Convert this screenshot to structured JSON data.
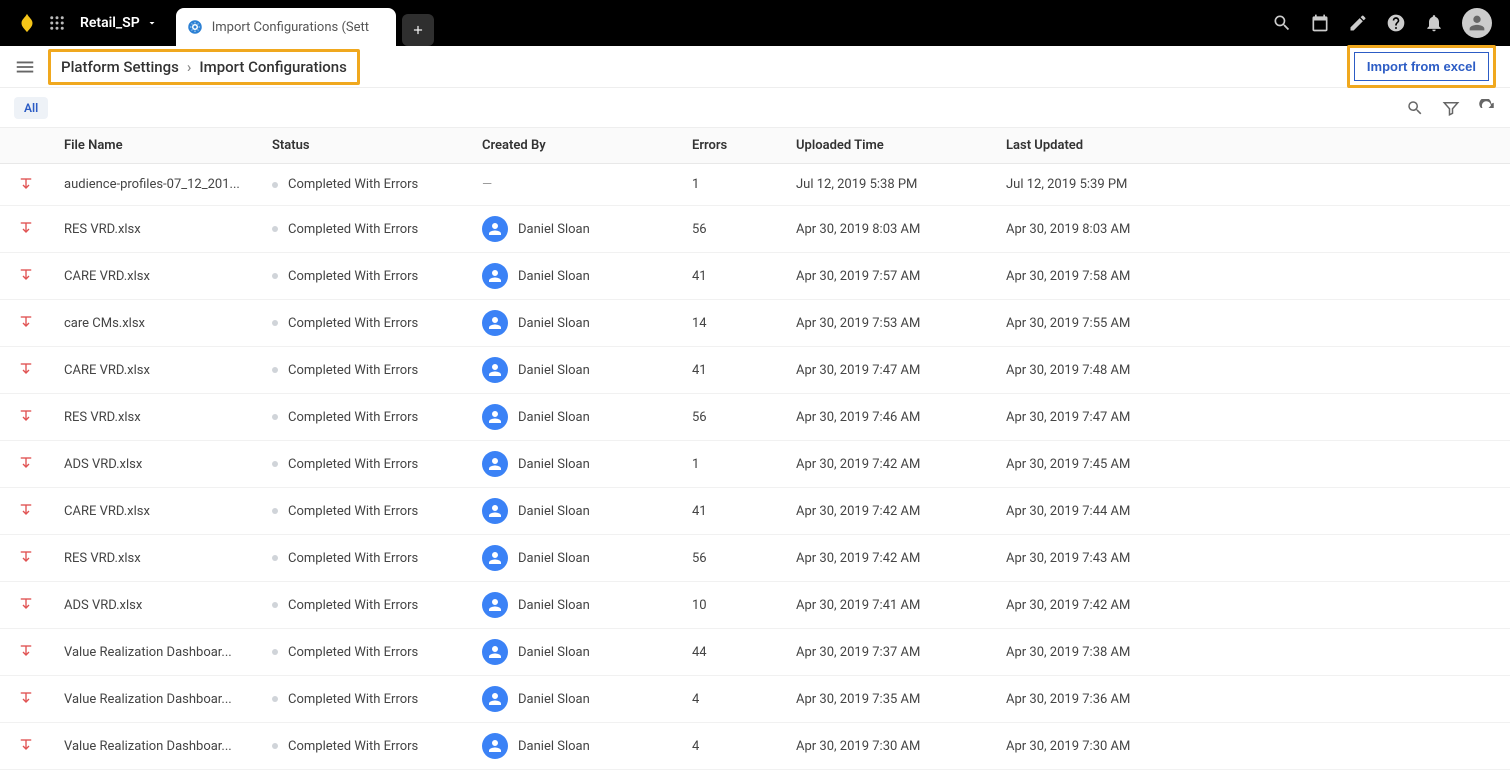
{
  "topbar": {
    "workspace": "Retail_SP",
    "tab_label": "Import Configurations (Sett"
  },
  "breadcrumb": {
    "parent": "Platform Settings",
    "current": "Import Configurations"
  },
  "actions": {
    "import_btn": "Import from excel",
    "filter_chip": "All"
  },
  "table": {
    "columns": {
      "file_name": "File Name",
      "status": "Status",
      "created_by": "Created By",
      "errors": "Errors",
      "uploaded_time": "Uploaded Time",
      "last_updated": "Last Updated"
    },
    "rows": [
      {
        "file_name": "audience-profiles-07_12_201...",
        "status": "Completed With Errors",
        "created_by": "",
        "errors": "1",
        "uploaded_time": "Jul 12, 2019 5:38 PM",
        "last_updated": "Jul 12, 2019 5:39 PM"
      },
      {
        "file_name": "RES VRD.xlsx",
        "status": "Completed With Errors",
        "created_by": "Daniel Sloan",
        "errors": "56",
        "uploaded_time": "Apr 30, 2019 8:03 AM",
        "last_updated": "Apr 30, 2019 8:03 AM"
      },
      {
        "file_name": "CARE VRD.xlsx",
        "status": "Completed With Errors",
        "created_by": "Daniel Sloan",
        "errors": "41",
        "uploaded_time": "Apr 30, 2019 7:57 AM",
        "last_updated": "Apr 30, 2019 7:58 AM"
      },
      {
        "file_name": "care CMs.xlsx",
        "status": "Completed With Errors",
        "created_by": "Daniel Sloan",
        "errors": "14",
        "uploaded_time": "Apr 30, 2019 7:53 AM",
        "last_updated": "Apr 30, 2019 7:55 AM"
      },
      {
        "file_name": "CARE VRD.xlsx",
        "status": "Completed With Errors",
        "created_by": "Daniel Sloan",
        "errors": "41",
        "uploaded_time": "Apr 30, 2019 7:47 AM",
        "last_updated": "Apr 30, 2019 7:48 AM"
      },
      {
        "file_name": "RES VRD.xlsx",
        "status": "Completed With Errors",
        "created_by": "Daniel Sloan",
        "errors": "56",
        "uploaded_time": "Apr 30, 2019 7:46 AM",
        "last_updated": "Apr 30, 2019 7:47 AM"
      },
      {
        "file_name": "ADS VRD.xlsx",
        "status": "Completed With Errors",
        "created_by": "Daniel Sloan",
        "errors": "1",
        "uploaded_time": "Apr 30, 2019 7:42 AM",
        "last_updated": "Apr 30, 2019 7:45 AM"
      },
      {
        "file_name": "CARE VRD.xlsx",
        "status": "Completed With Errors",
        "created_by": "Daniel Sloan",
        "errors": "41",
        "uploaded_time": "Apr 30, 2019 7:42 AM",
        "last_updated": "Apr 30, 2019 7:44 AM"
      },
      {
        "file_name": "RES VRD.xlsx",
        "status": "Completed With Errors",
        "created_by": "Daniel Sloan",
        "errors": "56",
        "uploaded_time": "Apr 30, 2019 7:42 AM",
        "last_updated": "Apr 30, 2019 7:43 AM"
      },
      {
        "file_name": "ADS VRD.xlsx",
        "status": "Completed With Errors",
        "created_by": "Daniel Sloan",
        "errors": "10",
        "uploaded_time": "Apr 30, 2019 7:41 AM",
        "last_updated": "Apr 30, 2019 7:42 AM"
      },
      {
        "file_name": "Value Realization Dashboar...",
        "status": "Completed With Errors",
        "created_by": "Daniel Sloan",
        "errors": "44",
        "uploaded_time": "Apr 30, 2019 7:37 AM",
        "last_updated": "Apr 30, 2019 7:38 AM"
      },
      {
        "file_name": "Value Realization Dashboar...",
        "status": "Completed With Errors",
        "created_by": "Daniel Sloan",
        "errors": "4",
        "uploaded_time": "Apr 30, 2019 7:35 AM",
        "last_updated": "Apr 30, 2019 7:36 AM"
      },
      {
        "file_name": "Value Realization Dashboar...",
        "status": "Completed With Errors",
        "created_by": "Daniel Sloan",
        "errors": "4",
        "uploaded_time": "Apr 30, 2019 7:30 AM",
        "last_updated": "Apr 30, 2019 7:30 AM"
      }
    ]
  }
}
